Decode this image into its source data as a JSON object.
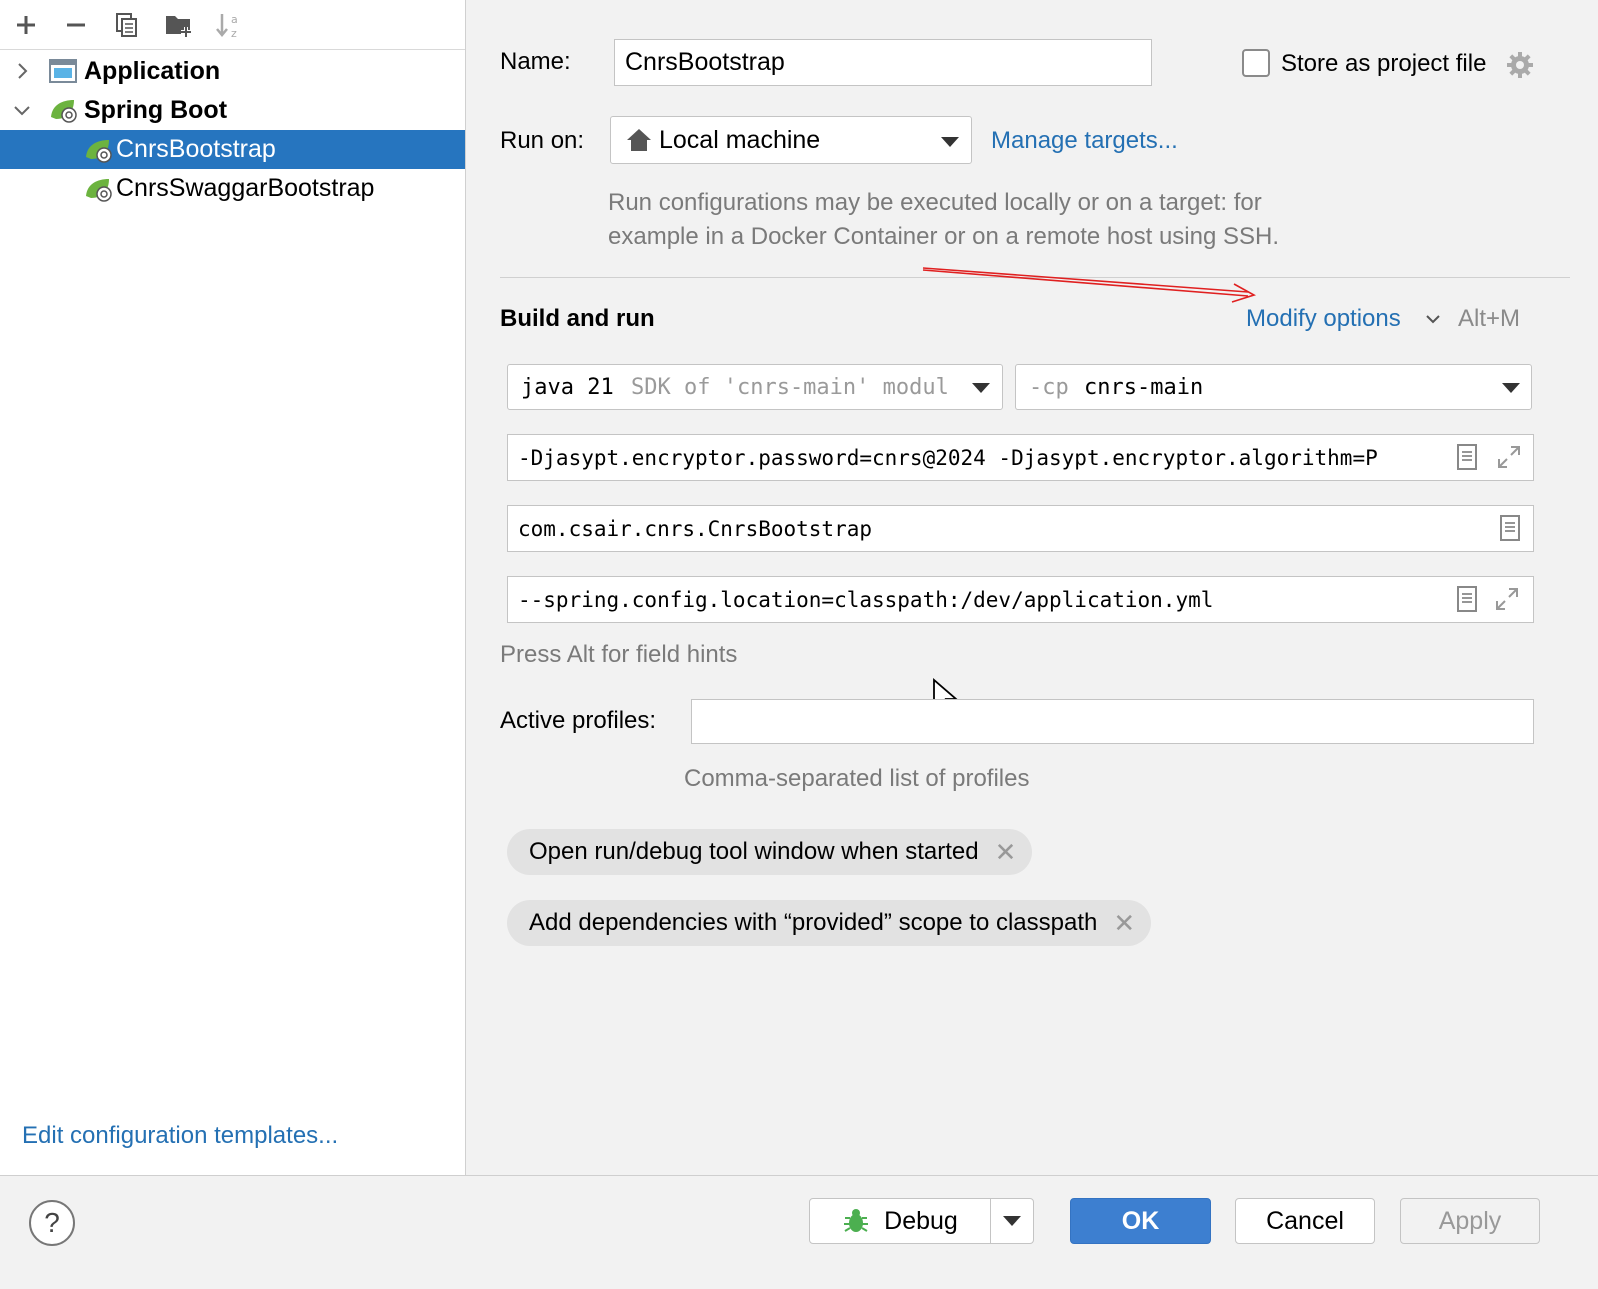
{
  "sidebar": {
    "toolbar": {
      "add_icon": "plus-icon",
      "remove_icon": "minus-icon",
      "copy_icon": "copy-icon",
      "folder_icon": "new-folder-icon",
      "sort_icon": "sort-az-icon"
    },
    "tree": [
      {
        "label": "Application",
        "expanded": false,
        "bold": true
      },
      {
        "label": "Spring Boot",
        "expanded": true,
        "bold": true
      },
      {
        "label": "CnrsBootstrap",
        "selected": true
      },
      {
        "label": "CnrsSwaggarBootstrap",
        "selected": false
      }
    ],
    "edit_templates": "Edit configuration templates..."
  },
  "form": {
    "name_label": "Name:",
    "name_value": "CnrsBootstrap",
    "store_label": "Store as project file",
    "store_checked": false,
    "run_on_label": "Run on:",
    "run_on_value": "Local machine",
    "manage_targets": "Manage targets...",
    "run_on_hint_1": "Run configurations may be executed locally or on a target: for",
    "run_on_hint_2": "example in a Docker Container or on a remote host using SSH.",
    "section_title": "Build and run",
    "modify_options": "Modify options",
    "modify_shortcut": "Alt+M",
    "sdk_java": "java 21",
    "sdk_hint": "SDK of 'cnrs-main' modul",
    "cp_prefix": "-cp",
    "cp_value": "cnrs-main",
    "vm_options": "-Djasypt.encryptor.password=cnrs@2024 -Djasypt.encryptor.algorithm=P",
    "main_class": "com.csair.cnrs.CnrsBootstrap",
    "program_args": "--spring.config.location=classpath:/dev/application.yml",
    "field_hints": "Press Alt for field hints",
    "profiles_label": "Active profiles:",
    "profiles_value": "",
    "profiles_hint": "Comma-separated list of profiles",
    "chips": [
      "Open run/debug tool window when started",
      "Add dependencies with “provided” scope to classpath"
    ]
  },
  "buttons": {
    "help": "?",
    "debug": "Debug",
    "ok": "OK",
    "cancel": "Cancel",
    "apply": "Apply"
  },
  "colors": {
    "accent": "#2675bf",
    "link": "#2470b3",
    "primary_button": "#3d7fd0",
    "annotation_arrow": "#e02020"
  }
}
